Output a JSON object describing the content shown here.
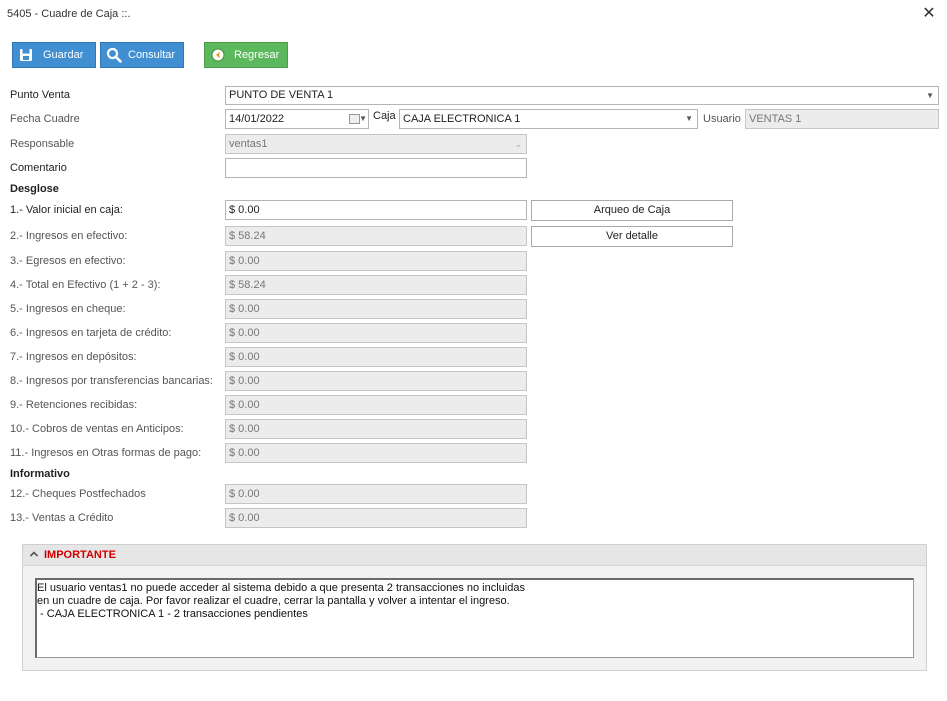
{
  "window": {
    "title": "5405 - Cuadre de Caja ::."
  },
  "toolbar": {
    "save": "Guardar",
    "query": "Consultar",
    "back": "Regresar"
  },
  "form": {
    "punto_venta_label": "Punto Venta",
    "punto_venta_value": "PUNTO DE VENTA 1",
    "fecha_label": "Fecha Cuadre",
    "fecha_value": "14/01/2022",
    "caja_label": "Caja",
    "caja_value": "CAJA ELECTRONICA 1",
    "usuario_label": "Usuario",
    "usuario_value": "VENTAS 1",
    "responsable_label": "Responsable",
    "responsable_value": "ventas1",
    "comentario_label": "Comentario",
    "comentario_value": ""
  },
  "desglose": {
    "heading": "Desglose",
    "items": [
      {
        "label": "1.- Valor inicial en caja:",
        "value": "$ 0.00"
      },
      {
        "label": "2.- Ingresos en efectivo:",
        "value": "$ 58.24"
      },
      {
        "label": "3.- Egresos en efectivo:",
        "value": "$ 0.00"
      },
      {
        "label": "4.- Total en Efectivo (1 + 2 - 3):",
        "value": "$ 58.24"
      },
      {
        "label": "5.- Ingresos en cheque:",
        "value": "$ 0.00"
      },
      {
        "label": "6.- Ingresos en tarjeta de crédito:",
        "value": "$ 0.00"
      },
      {
        "label": "7.- Ingresos en depósitos:",
        "value": "$ 0.00"
      },
      {
        "label": "8.- Ingresos por transferencias bancarias:",
        "value": "$ 0.00"
      },
      {
        "label": "9.- Retenciones recibidas:",
        "value": "$ 0.00"
      },
      {
        "label": "10.- Cobros de ventas en Anticipos:",
        "value": "$ 0.00"
      },
      {
        "label": "11.- Ingresos en Otras formas de pago:",
        "value": "$ 0.00"
      }
    ],
    "arqueo_button": "Arqueo de Caja",
    "detalle_button": "Ver detalle"
  },
  "informativo": {
    "heading": "Informativo",
    "items": [
      {
        "label": "12.- Cheques Postfechados",
        "value": "$ 0.00"
      },
      {
        "label": "13.- Ventas a Crédito",
        "value": "$ 0.00"
      }
    ]
  },
  "important": {
    "title": "IMPORTANTE",
    "lines": [
      "El usuario ventas1 no puede acceder al sistema debido a que presenta 2 transacciones no incluidas",
      "en un cuadre de caja. Por favor realizar el cuadre, cerrar la pantalla y volver a intentar el ingreso.",
      " - CAJA ELECTRONICA 1 - 2 transacciones pendientes"
    ]
  }
}
